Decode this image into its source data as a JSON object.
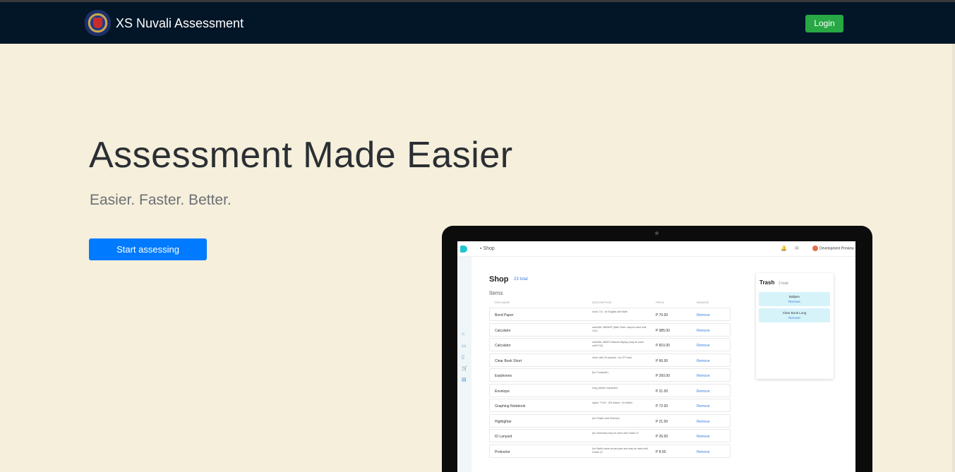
{
  "navbar": {
    "brand_name": "XS Nuvali Assessment",
    "login_label": "Login"
  },
  "hero": {
    "title": "Assessment Made Easier",
    "subtitle": "Easier. Faster. Better.",
    "cta_label": "Start assessing"
  },
  "preview": {
    "crumb": "Shop",
    "user_name": "Development Preview",
    "shop_title": "Shop",
    "shop_total": "23 total",
    "items_label": "Items",
    "columns": [
      "ITEM NAME",
      "DESCRIPTION",
      "PRICE",
      "REMOVE"
    ],
    "rows": [
      {
        "name": "Bond Paper",
        "desc": "short, 0.5 - for English and Math",
        "price": "P 70.00",
        "action": "Remove"
      },
      {
        "name": "Calculator",
        "desc": "scientific, 580MSP (After Yeah: may be used until G11)",
        "price": "P 985.00",
        "action": "Remove"
      },
      {
        "name": "Calculator",
        "desc": "scientific, 680ES Natural Display (may be used until G12)",
        "price": "P 810.00",
        "action": "Remove"
      },
      {
        "name": "Clear Book Short",
        "desc": "short, with 20 pockets - for CFI read",
        "price": "P 66.00",
        "action": "Remove"
      },
      {
        "name": "Earphones",
        "desc": "(for Computer)",
        "price": "P 260.00",
        "action": "Remove"
      },
      {
        "name": "Envelope",
        "desc": "long, plastic, expanded",
        "price": "P 21.00",
        "action": "Remove"
      },
      {
        "name": "Graphing Notebook",
        "desc": "spiral, 7\"x10\", 100 leaves - for Maths",
        "price": "P 72.00",
        "action": "Remove"
      },
      {
        "name": "Highlighter",
        "desc": "(for Filipino and Science)",
        "price": "P 21.00",
        "action": "Remove"
      },
      {
        "name": "ID Lanyard",
        "desc": "(for Sciences) may be used until Grade 12",
        "price": "P 26.00",
        "action": "Remove"
      },
      {
        "name": "Protractor",
        "desc": "(for Math) same as last year and may be used until Grade 12",
        "price": "P 8.00",
        "action": "Remove"
      }
    ],
    "trash": {
      "title": "Trash",
      "total": "2 total",
      "items": [
        {
          "name": "Ballpen",
          "action": "Remove"
        },
        {
          "name": "Clear Book Long",
          "action": "Remove"
        }
      ]
    }
  },
  "colors": {
    "navbar_bg": "#021628",
    "page_bg": "#f5efdc",
    "login_green": "#28a745",
    "cta_blue": "#007bff"
  }
}
